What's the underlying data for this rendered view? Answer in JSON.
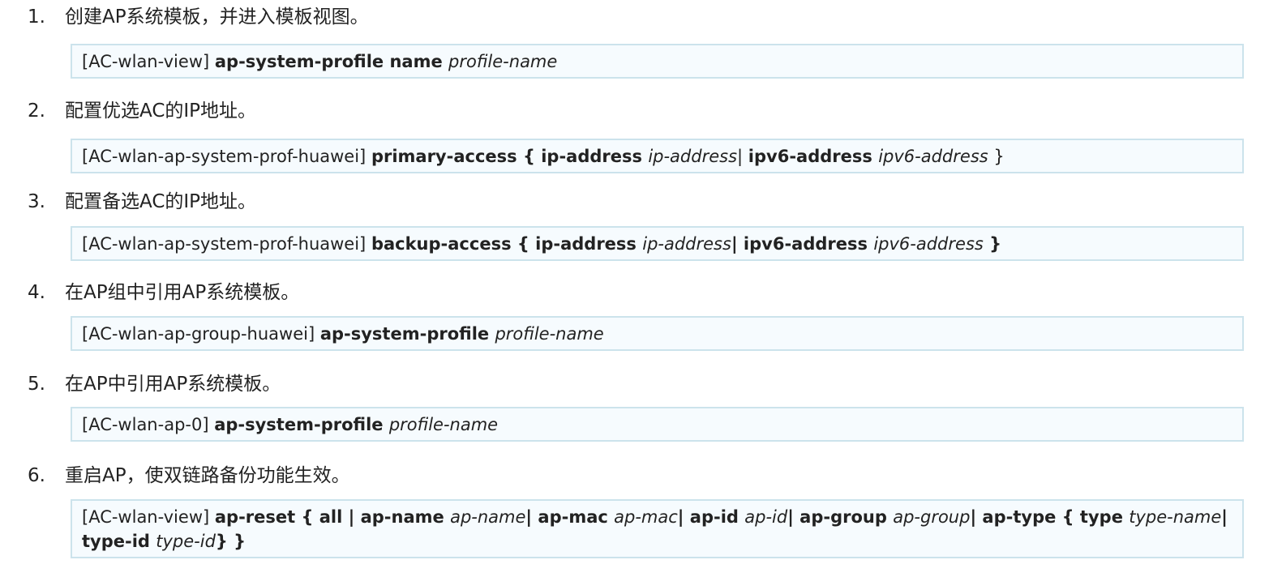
{
  "steps": [
    {
      "number": "1.",
      "title": "创建AP系统模板，并进入模板视图。",
      "command": [
        {
          "t": "n",
          "v": "[AC-wlan-view] "
        },
        {
          "t": "b",
          "v": "ap-system-profile name "
        },
        {
          "t": "i",
          "v": "profile-name"
        }
      ]
    },
    {
      "number": "2.",
      "title": "配置优选AC的IP地址。",
      "command": [
        {
          "t": "n",
          "v": "[AC-wlan-ap-system-prof-huawei] "
        },
        {
          "t": "b",
          "v": "primary-access { ip-address "
        },
        {
          "t": "i",
          "v": "ip-address"
        },
        {
          "t": "n",
          "v": "| "
        },
        {
          "t": "b",
          "v": "ipv6-address "
        },
        {
          "t": "i",
          "v": "ipv6-address"
        },
        {
          "t": "n",
          "v": " }"
        }
      ]
    },
    {
      "number": "3.",
      "title": "配置备选AC的IP地址。",
      "command": [
        {
          "t": "n",
          "v": "[AC-wlan-ap-system-prof-huawei] "
        },
        {
          "t": "b",
          "v": "backup-access { ip-address "
        },
        {
          "t": "i",
          "v": "ip-address"
        },
        {
          "t": "b",
          "v": "| ipv6-address "
        },
        {
          "t": "i",
          "v": "ipv6-address"
        },
        {
          "t": "b",
          "v": " }"
        }
      ]
    },
    {
      "number": "4.",
      "title": "在AP组中引用AP系统模板。",
      "command": [
        {
          "t": "n",
          "v": "[AC-wlan-ap-group-huawei] "
        },
        {
          "t": "b",
          "v": "ap-system-profile "
        },
        {
          "t": "i",
          "v": "profile-name"
        }
      ]
    },
    {
      "number": "5.",
      "title": "在AP中引用AP系统模板。",
      "command": [
        {
          "t": "n",
          "v": "[AC-wlan-ap-0] "
        },
        {
          "t": "b",
          "v": "ap-system-profile "
        },
        {
          "t": "i",
          "v": "profile-name"
        }
      ]
    },
    {
      "number": "6.",
      "title": "重启AP，使双链路备份功能生效。",
      "command": [
        {
          "t": "n",
          "v": "[AC-wlan-view] "
        },
        {
          "t": "b",
          "v": "ap-reset { all | ap-name "
        },
        {
          "t": "i",
          "v": "ap-name"
        },
        {
          "t": "b",
          "v": "| ap-mac "
        },
        {
          "t": "i",
          "v": "ap-mac"
        },
        {
          "t": "b",
          "v": "| ap-id "
        },
        {
          "t": "i",
          "v": "ap-id"
        },
        {
          "t": "b",
          "v": "| ap-group "
        },
        {
          "t": "i",
          "v": "ap-group"
        },
        {
          "t": "b",
          "v": "| ap-type { type "
        },
        {
          "t": "i",
          "v": "type-name"
        },
        {
          "t": "b",
          "v": "| type-id "
        },
        {
          "t": "i",
          "v": "type-id"
        },
        {
          "t": "b",
          "v": "} }"
        }
      ]
    }
  ],
  "colors": {
    "text": "#222222",
    "code_bg": "#f6fbfe",
    "code_border": "#cce3ec"
  }
}
